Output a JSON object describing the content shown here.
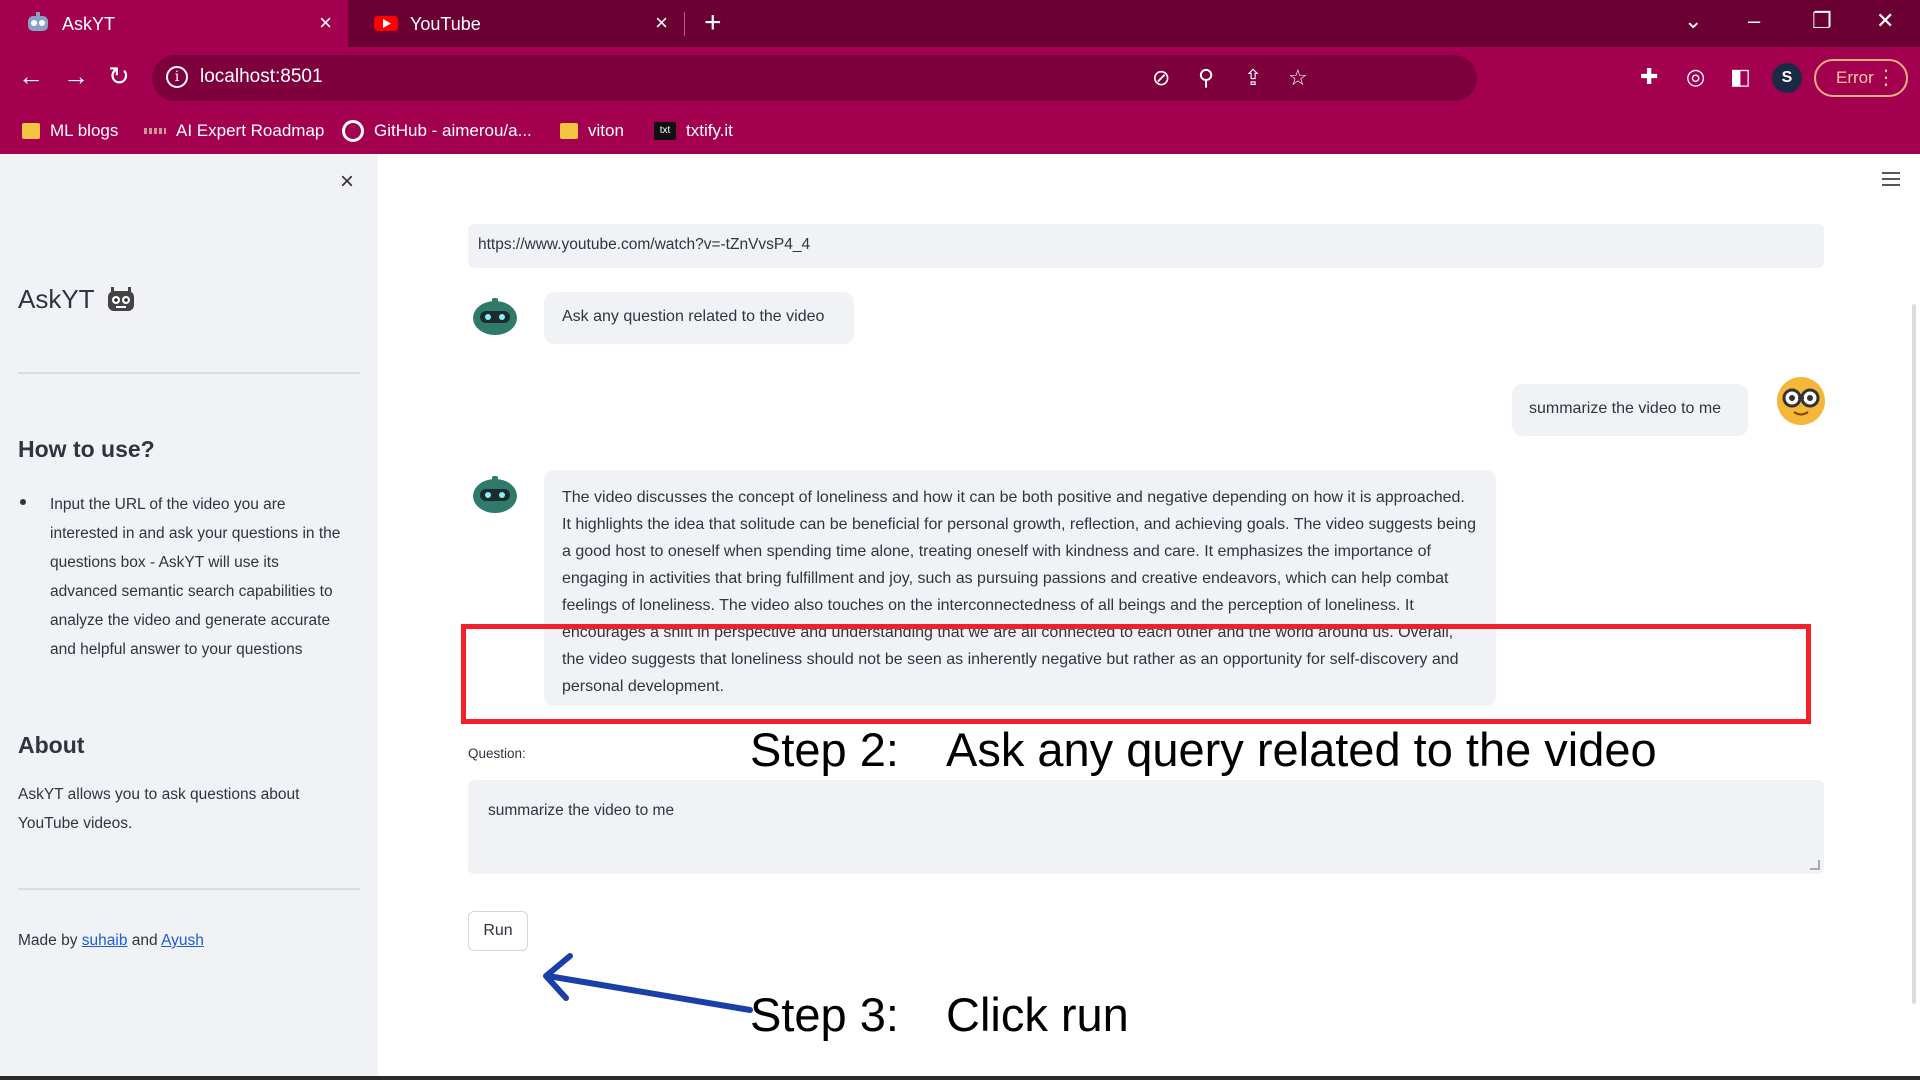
{
  "browser": {
    "tabs": [
      {
        "title": "AskYT",
        "close": "×"
      },
      {
        "title": "YouTube",
        "close": "×"
      }
    ],
    "new_tab": "+",
    "address": "localhost:8501",
    "error_label": "Error",
    "bookmarks": [
      "ML blogs",
      "AI Expert Roadmap",
      "GitHub - aimerou/a...",
      "viton",
      "txtify.it"
    ],
    "profile_initial": "S"
  },
  "sidebar": {
    "close": "×",
    "app_title": "AskYT",
    "how_to_title": "How to use?",
    "how_to_item": "Input the URL of the video you are interested in and ask your questions in the questions box - AskYT will use its advanced semantic search capabilities to analyze the video and generate accurate and helpful answer to your questions",
    "about_title": "About",
    "about_text": "AskYT allows you to ask questions about YouTube videos.",
    "made_by_prefix": "Made by",
    "author1": "suhaib",
    "and_word": "and",
    "author2": "Ayush"
  },
  "main": {
    "url_value": "https://www.youtube.com/watch?v=-tZnVvsP4_4",
    "messages": [
      {
        "role": "assistant",
        "text": "Ask any question related to the video"
      },
      {
        "role": "user",
        "text": "summarize the video to me"
      },
      {
        "role": "assistant",
        "text": "The video discusses the concept of loneliness and how it can be both positive and negative depending on how it is approached. It highlights the idea that solitude can be beneficial for personal growth, reflection, and achieving goals. The video suggests being a good host to oneself when spending time alone, treating oneself with kindness and care. It emphasizes the importance of engaging in activities that bring fulfillment and joy, such as pursuing passions and creative endeavors, which can help combat feelings of loneliness. The video also touches on the interconnectedness of all beings and the perception of loneliness. It encourages a shift in perspective and understanding that we are all connected to each other and the world around us. Overall, the video suggests that loneliness should not be seen as inherently negative but rather as an opportunity for self-discovery and personal development."
      }
    ],
    "question_label": "Question:",
    "question_value": "summarize the video to me",
    "run_label": "Run"
  },
  "annotations": {
    "step2_label": "Step 2:",
    "step2_text": "Ask any query related to the video",
    "step3_label": "Step 3:",
    "step3_text": "Click run"
  },
  "colors": {
    "tabstrip": "#6b0033",
    "toolbar": "#a3004f",
    "sidebar_bg": "#f0f2f6",
    "highlight_box": "#f0202d",
    "arrow": "#1a3fa8",
    "link": "#1a5ecf"
  }
}
